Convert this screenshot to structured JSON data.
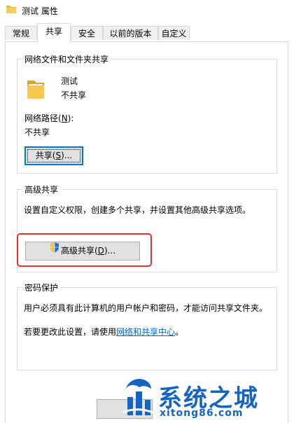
{
  "window": {
    "title": "测试 属性",
    "icon": "folder-icon"
  },
  "tabs": [
    {
      "label": "常规"
    },
    {
      "label": "共享",
      "active": true
    },
    {
      "label": "安全"
    },
    {
      "label": "以前的版本"
    },
    {
      "label": "自定义"
    }
  ],
  "network_sharing": {
    "group_title": "网络文件和文件夹共享",
    "folder_name": "测试",
    "folder_status": "不共享",
    "path_label_prefix": "网络路径(",
    "path_label_key": "N",
    "path_label_suffix": "):",
    "path_value": "不共享",
    "share_button": {
      "prefix": "共享(",
      "key": "S",
      "suffix": ")..."
    }
  },
  "advanced_sharing": {
    "group_title": "高级共享",
    "description": "设置自定义权限，创建多个共享，并设置其他高级共享选项。",
    "button": {
      "prefix": "高级共享(",
      "key": "D",
      "suffix": ")...",
      "icon": "shield-icon"
    }
  },
  "password_protection": {
    "group_title": "密码保护",
    "description": "用户必须具有此计算机的用户帐户和密码，才能访问共享文件夹。",
    "change_prefix": "若要更改此设置，请使用",
    "link": "网络和共享中心",
    "change_suffix": "。"
  },
  "watermark": {
    "text": "系统之城",
    "sub": "xitong86.com",
    "color": "#1565c0"
  },
  "colors": {
    "highlight": "#e03131",
    "link": "#0066cc",
    "default_button_border": "#0078d7"
  }
}
